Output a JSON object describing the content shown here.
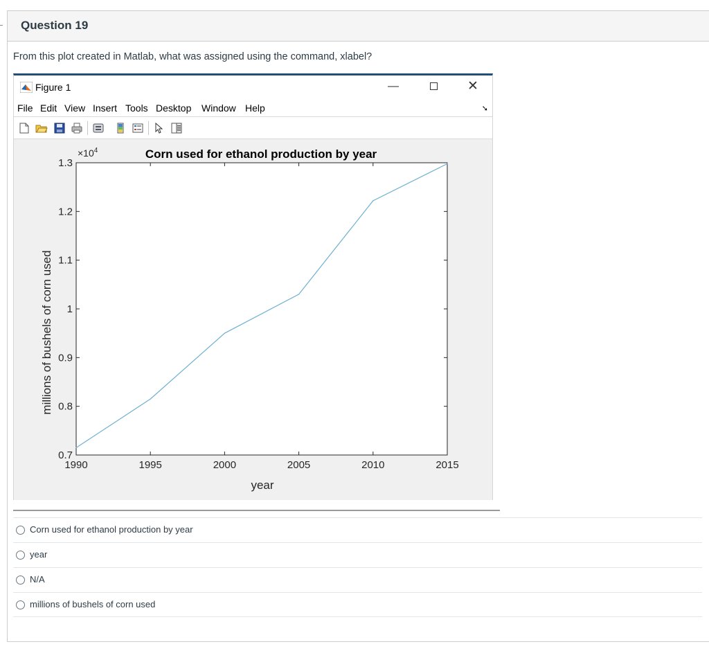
{
  "question": {
    "title": "Question 19",
    "text": "From this plot created in Matlab, what was assigned using the command, xlabel?"
  },
  "figure_window": {
    "title": "Figure 1",
    "menu": [
      "File",
      "Edit",
      "View",
      "Insert",
      "Tools",
      "Desktop",
      "Window",
      "Help"
    ],
    "window_buttons": {
      "minimize": "—",
      "close": "✕"
    }
  },
  "chart_data": {
    "type": "line",
    "title": "Corn used for ethanol production by year",
    "xlabel": "year",
    "ylabel": "millions of bushels of corn used",
    "y_exponent_label": "×10",
    "y_exponent_power": "4",
    "xlim": [
      1990,
      2015
    ],
    "ylim": [
      0.7,
      1.3
    ],
    "x_ticks": [
      "1990",
      "1995",
      "2000",
      "2005",
      "2010",
      "2015"
    ],
    "y_ticks": [
      "0.7",
      "0.8",
      "0.9",
      "1",
      "1.1",
      "1.2",
      "1.3"
    ],
    "x": [
      1990,
      1995,
      2000,
      2005,
      2010,
      2015
    ],
    "values": [
      0.715,
      0.815,
      0.95,
      1.03,
      1.222,
      1.298
    ],
    "line_color": "#6fb0d1"
  },
  "answers": [
    {
      "label": "Corn used for ethanol production by year"
    },
    {
      "label": "year"
    },
    {
      "label": "N/A"
    },
    {
      "label": "millions of bushels of corn used"
    }
  ]
}
